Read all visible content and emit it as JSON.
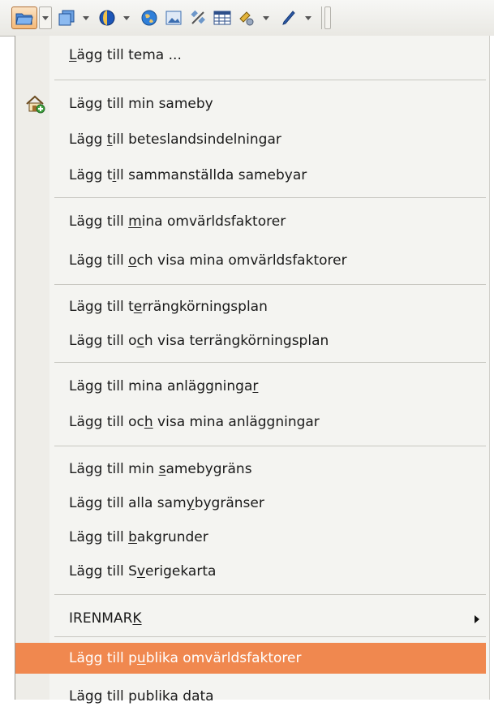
{
  "toolbar": {
    "icons": [
      "open-folder-icon",
      "copy-layers-icon",
      "globe-icon",
      "world-icon",
      "image-icon",
      "satellite-icon",
      "table-icon",
      "map-tool-icon",
      "pen-icon"
    ],
    "accent": "#f5b977"
  },
  "menu": {
    "highlight_color": "#f0884f",
    "items": [
      {
        "pre": "",
        "u": "L",
        "post": "ägg till tema ..."
      },
      {
        "pre": "Lägg till min sameby",
        "u": "",
        "post": ""
      },
      {
        "pre": "Lägg ",
        "u": "t",
        "post": "ill beteslandsindelningar"
      },
      {
        "pre": "Lägg t",
        "u": "i",
        "post": "ll sammanställda samebyar"
      },
      {
        "pre": "Lägg till ",
        "u": "m",
        "post": "ina omvärldsfaktorer"
      },
      {
        "pre": "Lägg till ",
        "u": "o",
        "post": "ch visa mina omvärldsfaktorer"
      },
      {
        "pre": "Lägg till t",
        "u": "e",
        "post": "rrängkörningsplan"
      },
      {
        "pre": "Lägg till o",
        "u": "c",
        "post": "h visa terrängkörningsplan"
      },
      {
        "pre": "Lägg till mina anläggninga",
        "u": "r",
        "post": ""
      },
      {
        "pre": "Lägg till oc",
        "u": "h",
        "post": " visa mina anläggningar"
      },
      {
        "pre": "Lägg till min ",
        "u": "s",
        "post": "amebygräns"
      },
      {
        "pre": "Lägg till alla sam",
        "u": "y",
        "post": "bygränser"
      },
      {
        "pre": "Lägg till ",
        "u": "b",
        "post": "akgrunder"
      },
      {
        "pre": "Lägg till S",
        "u": "v",
        "post": "erigekarta"
      },
      {
        "pre": "IRENMAR",
        "u": "K",
        "post": ""
      },
      {
        "pre": "Lägg till p",
        "u": "u",
        "post": "blika omvärldsfaktorer"
      },
      {
        "pre": "Lägg till publika data",
        "u": "",
        "post": ""
      }
    ]
  }
}
